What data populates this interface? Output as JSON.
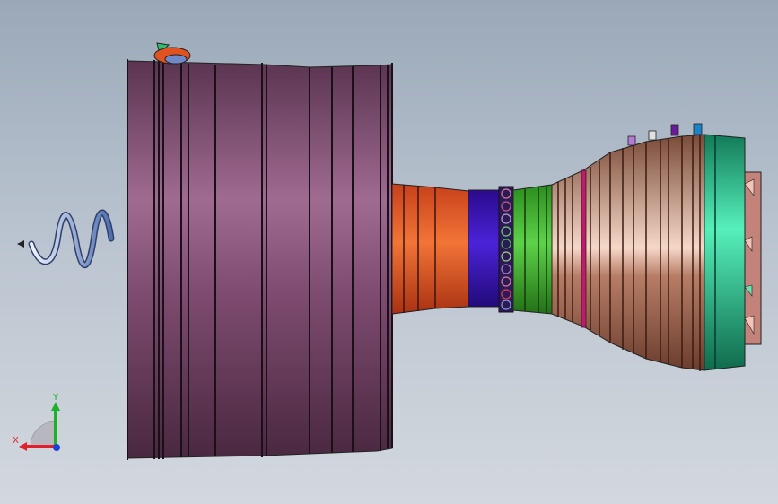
{
  "viewport": {
    "background_top": "#9aa8b8",
    "background_bottom": "#d3d8de"
  },
  "model": {
    "sections": [
      {
        "name": "fan-casing",
        "color": "#6b3d5c"
      },
      {
        "name": "intake-cone",
        "color": "#e0521f"
      },
      {
        "name": "compressor-ring",
        "color": "#3d12b8"
      },
      {
        "name": "bearing-ring",
        "color": "#2a1a5a"
      },
      {
        "name": "green-stage",
        "color": "#3cae2a"
      },
      {
        "name": "turbine-body",
        "color": "#a66d56"
      },
      {
        "name": "exhaust-ring",
        "color": "#1fa877"
      },
      {
        "name": "nozzle",
        "color": "#e59b8d"
      }
    ]
  },
  "triad": {
    "x_label": "X",
    "y_label": "Y",
    "x_color": "#e2202b",
    "y_color": "#1ab22b",
    "z_color": "#1c3fe0"
  }
}
